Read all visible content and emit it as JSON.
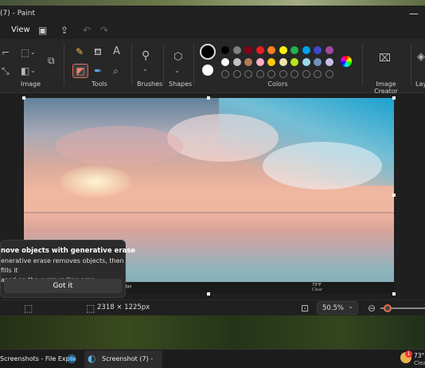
{
  "window": {
    "title": "(7) - Paint",
    "controls": "—"
  },
  "menu": {
    "view": "View"
  },
  "ribbon": {
    "groups": {
      "image": "Image",
      "tools": "Tools",
      "brushes": "Brushes",
      "shapes": "Shapes",
      "colors": "Colors",
      "image_creator": "Image Creator",
      "layers": "Lay"
    },
    "text_tool": "A"
  },
  "colors": {
    "row1": [
      "#000000",
      "#7f7f7f",
      "#880015",
      "#ed1c24",
      "#ff7f27",
      "#fff200",
      "#22b14c",
      "#00a2e8",
      "#3f48cc",
      "#a349a4"
    ],
    "row2": [
      "#ffffff",
      "#c3c3c3",
      "#b97a57",
      "#ffaec9",
      "#ffc90e",
      "#efe4b0",
      "#b5e61d",
      "#99d9ea",
      "#7092be",
      "#c8bfe7"
    ],
    "primary": "#000000",
    "secondary": "#ffffff"
  },
  "popup": {
    "heading": "nove objects with generative erase",
    "line1": "enerative erase removes objects, then fills it",
    "line2": "ased on the surrounding area",
    "button": "Got it"
  },
  "canvas_screen": {
    "taskbar_text": "dge",
    "weather": "73°F",
    "weather_sub": "Clear"
  },
  "statusbar": {
    "dimensions": "2318 × 1225px",
    "zoom": "50.5%"
  },
  "taskbar": {
    "app1": "Screenshots - File Explo",
    "app2": "Screenshot (7) - Paint",
    "weather_temp": "73°F",
    "weather_cond": "Clea",
    "badge": "1"
  }
}
